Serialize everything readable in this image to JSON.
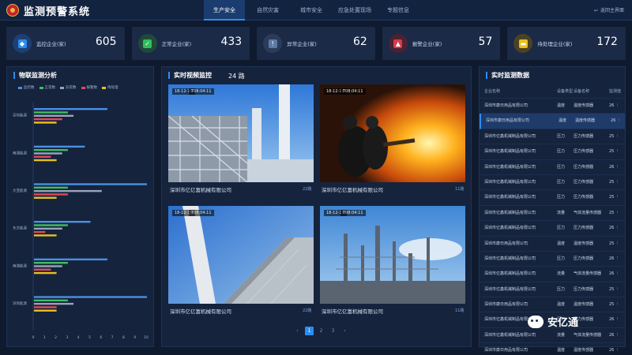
{
  "header": {
    "title": "监测预警系统",
    "nav": [
      "生产安全",
      "自然灾害",
      "城市安全",
      "应急处置现场",
      "专题信息"
    ],
    "active_nav": 0,
    "back_label": "返回主界面"
  },
  "stats": [
    {
      "label": "监控企业(家)",
      "value": "605",
      "color": "#2d8cf0",
      "icon": "monitor-icon"
    },
    {
      "label": "正常企业(家)",
      "value": "433",
      "color": "#2fbf5b",
      "icon": "check-icon"
    },
    {
      "label": "异常企业(家)",
      "value": "62",
      "color": "#5b7ba6",
      "icon": "exclamation-icon"
    },
    {
      "label": "报警企业(家)",
      "value": "57",
      "color": "#d83a4a",
      "icon": "alarm-icon"
    },
    {
      "label": "待处理企业(家)",
      "value": "172",
      "color": "#e8c020",
      "icon": "pending-icon"
    }
  ],
  "left_panel": {
    "title": "物联监测分析",
    "legend": [
      "监控数",
      "正常数",
      "异常数",
      "报警数",
      "待处理"
    ],
    "legend_colors": [
      "#4a90e2",
      "#3fbf5f",
      "#9aa4b8",
      "#e04a5a",
      "#e8c020"
    ]
  },
  "chart_data": {
    "type": "bar",
    "orientation": "horizontal",
    "categories": [
      "深圳能源",
      "南湖能源",
      "大亚能源",
      "东方能源",
      "南湖能源",
      "深圳能源"
    ],
    "series": [
      {
        "name": "监控数",
        "values": [
          6.5,
          4.5,
          10,
          5,
          6.5,
          10
        ]
      },
      {
        "name": "正常数",
        "values": [
          3,
          3,
          3,
          3,
          3,
          3
        ]
      },
      {
        "name": "异常数",
        "values": [
          3.5,
          2.5,
          6,
          2.5,
          2.5,
          3.5
        ]
      },
      {
        "name": "报警数",
        "values": [
          2.5,
          1.5,
          3,
          1,
          1.5,
          2
        ]
      },
      {
        "name": "待处理",
        "values": [
          2,
          2,
          2,
          2,
          2,
          2
        ]
      }
    ],
    "xlim": [
      0,
      10
    ],
    "xticks": [
      "0",
      "1",
      "2",
      "3",
      "4",
      "5",
      "6",
      "7",
      "8",
      "9",
      "10"
    ],
    "grid": false,
    "legend_position": "top"
  },
  "video_panel": {
    "title": "实时视频监控",
    "count_label": "24 路",
    "cameras": [
      {
        "date": "18-12-19",
        "time": "T08:04:11",
        "name": "深圳市亿亿富机械有限公司",
        "count": "22路",
        "scene": "factory"
      },
      {
        "date": "18-12-19",
        "time": "T08:04:11",
        "name": "深圳市亿亿富机械有限公司",
        "count": "11路",
        "scene": "fire"
      },
      {
        "date": "18-12-19",
        "time": "T08:04:11",
        "name": "深圳市亿亿富机械有限公司",
        "count": "22路",
        "scene": "chimney"
      },
      {
        "date": "18-12-19",
        "time": "T08:04:11",
        "name": "深圳市亿亿富机械有限公司",
        "count": "11路",
        "scene": "refinery"
      }
    ],
    "pager": {
      "prev": "‹",
      "pages": [
        "1",
        "2",
        "3"
      ],
      "active": 0,
      "next": "›"
    }
  },
  "table_panel": {
    "title": "实时监测数据",
    "columns": [
      "企业名称",
      "设备类型",
      "设备名称",
      "监测值"
    ],
    "rows": [
      {
        "name": "深圳市康日用品有限公司",
        "type": "温度",
        "device": "温度传感器",
        "value": "26",
        "selected": false
      },
      {
        "name": "深圳市康日用品有限公司",
        "type": "温度",
        "device": "温度传感器",
        "value": "26",
        "selected": true
      },
      {
        "name": "深圳市亿鑫机械制品有限公司",
        "type": "压力",
        "device": "压力传感器",
        "value": "25",
        "selected": false
      },
      {
        "name": "深圳市亿鑫机械制品有限公司",
        "type": "压力",
        "device": "压力传感器",
        "value": "25",
        "selected": false
      },
      {
        "name": "深圳市亿鑫机械制品有限公司",
        "type": "压力",
        "device": "压力传感器",
        "value": "26",
        "selected": false
      },
      {
        "name": "深圳市亿鑫机械制品有限公司",
        "type": "压力",
        "device": "压力传感器",
        "value": "25",
        "selected": false
      },
      {
        "name": "深圳市亿鑫机械制品有限公司",
        "type": "压力",
        "device": "压力传感器",
        "value": "25",
        "selected": false
      },
      {
        "name": "深圳市亿鑫机械制品有限公司",
        "type": "流量",
        "device": "气体流量传感器",
        "value": "25",
        "selected": false
      },
      {
        "name": "深圳市亿鑫机械制品有限公司",
        "type": "压力",
        "device": "压力传感器",
        "value": "26",
        "selected": false
      },
      {
        "name": "深圳市康日用品有限公司",
        "type": "温度",
        "device": "温度传感器",
        "value": "25",
        "selected": false
      },
      {
        "name": "深圳市亿鑫机械制品有限公司",
        "type": "压力",
        "device": "压力传感器",
        "value": "26",
        "selected": false
      },
      {
        "name": "深圳市亿鑫机械制品有限公司",
        "type": "流量",
        "device": "气体流量传感器",
        "value": "26",
        "selected": false
      },
      {
        "name": "深圳市亿鑫机械制品有限公司",
        "type": "压力",
        "device": "压力传感器",
        "value": "25",
        "selected": false
      },
      {
        "name": "深圳市康日用品有限公司",
        "type": "温度",
        "device": "温度传感器",
        "value": "25",
        "selected": false
      },
      {
        "name": "深圳市亿鑫机械制品有限公司",
        "type": "压力",
        "device": "压力传感器",
        "value": "26",
        "selected": false
      },
      {
        "name": "深圳市亿鑫机械制品有限公司",
        "type": "流量",
        "device": "气体流量传感器",
        "value": "26",
        "selected": false
      },
      {
        "name": "深圳市康日用品有限公司",
        "type": "温度",
        "device": "温度传感器",
        "value": "26",
        "selected": false
      }
    ]
  },
  "watermark": {
    "text": "安亿通"
  }
}
